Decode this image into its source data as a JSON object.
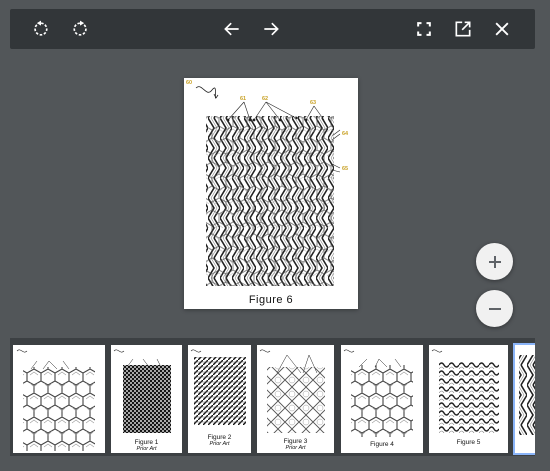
{
  "toolbar": {
    "icons": [
      "rotate-left-icon",
      "rotate-right-icon",
      "arrow-left-icon",
      "arrow-right-icon",
      "fullscreen-icon",
      "open-external-icon",
      "close-icon"
    ],
    "icon_color": "#ffffff"
  },
  "main_page": {
    "caption": "Figure 6",
    "labels": [
      "60",
      "61",
      "62",
      "63",
      "64",
      "65"
    ],
    "label_color": "#c9a227"
  },
  "zoom": {
    "in_label": "+",
    "out_label": "−"
  },
  "thumbnails": [
    {
      "caption": "",
      "sub": ""
    },
    {
      "caption": "Figure 1",
      "sub": "Prior Art"
    },
    {
      "caption": "Figure 2",
      "sub": "Prior Art"
    },
    {
      "caption": "Figure 3",
      "sub": "Prior Art"
    },
    {
      "caption": "Figure 4",
      "sub": ""
    },
    {
      "caption": "Figure 5",
      "sub": ""
    },
    {
      "caption": "",
      "sub": ""
    }
  ],
  "colors": {
    "background": "#525659",
    "toolbar": "#323639",
    "strip": "#3c4043",
    "selection": "#8ab4f8"
  }
}
